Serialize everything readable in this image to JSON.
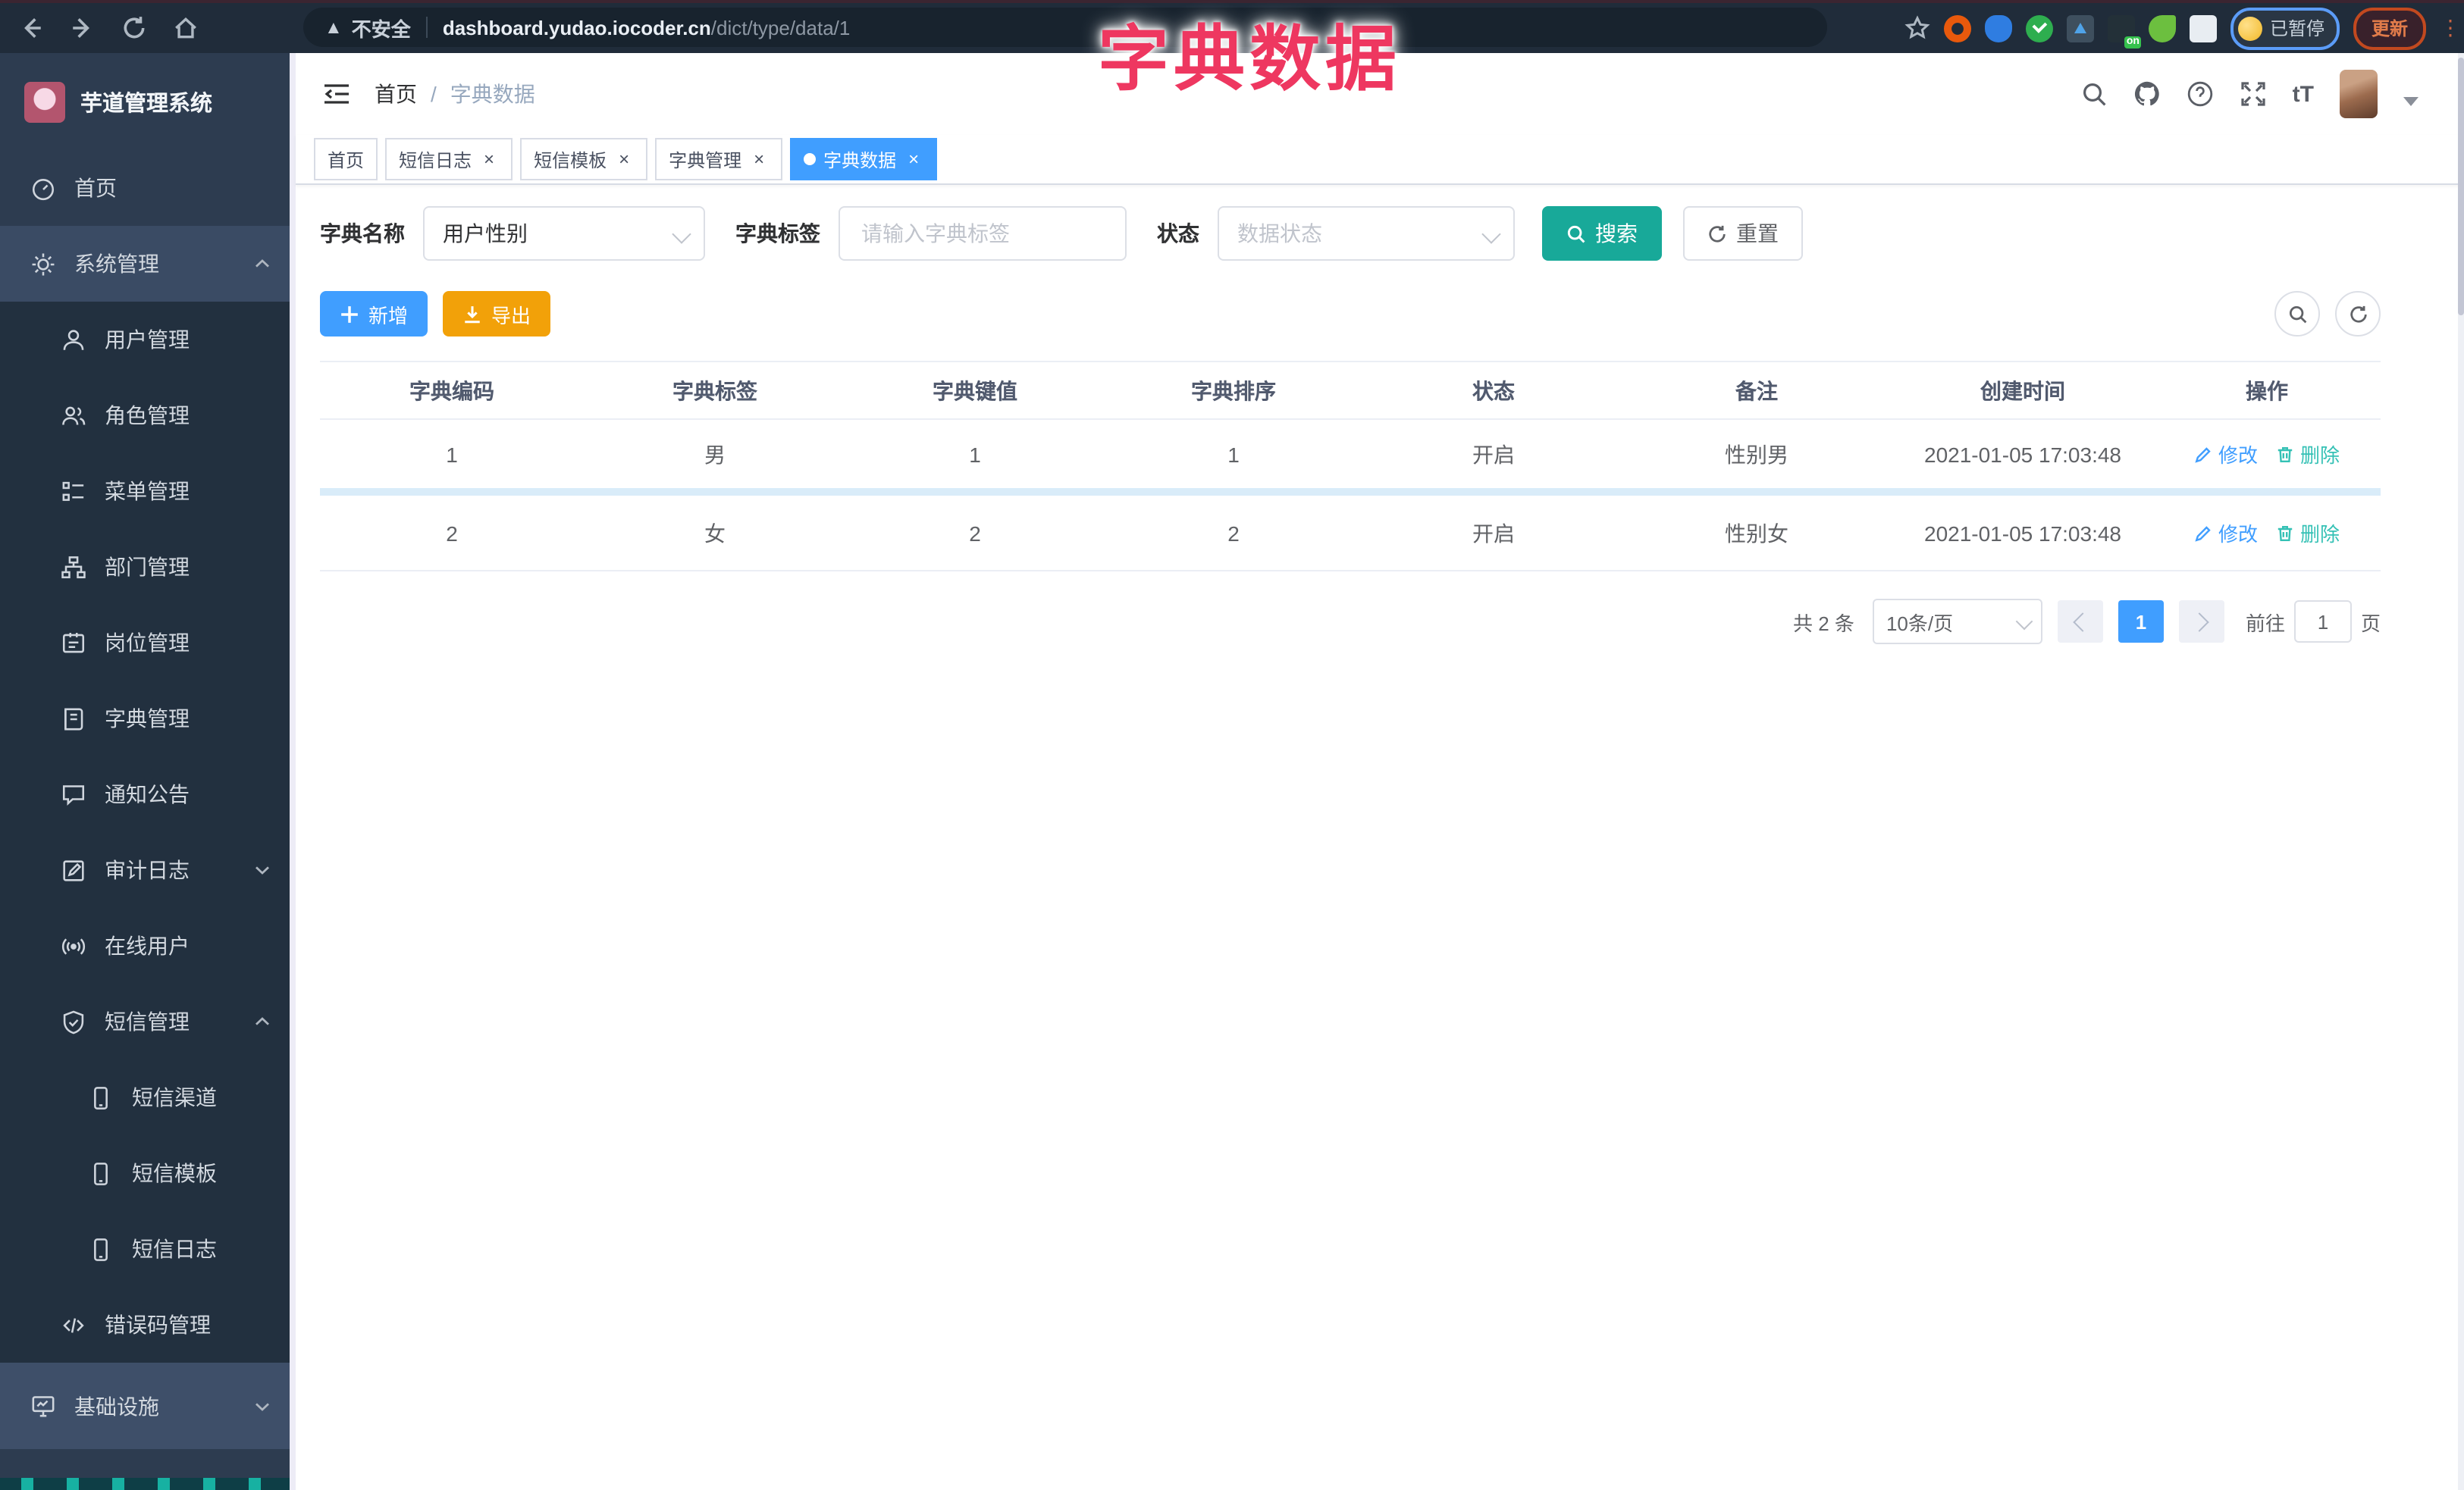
{
  "browser": {
    "security_label": "不安全",
    "url_host": "dashboard.yudao.iocoder.cn",
    "url_path": "/dict/type/data/1",
    "ext_on_badge": "on",
    "profile_status": "已暂停",
    "update_label": "更新",
    "extension_icons": [
      "back-icon",
      "forward-icon",
      "reload-icon",
      "home-icon",
      "bookmark-star-icon",
      "orange-extension-icon",
      "blue-extension-icon",
      "green-check-extension-icon",
      "levels-extension-icon",
      "on-badge-extension-icon",
      "sprout-extension-icon",
      "puzzle-extensions-icon",
      "profile-avatar",
      "kebab-menu-icon"
    ]
  },
  "overlay_title": "字典数据",
  "sidebar": {
    "app_title": "芋道管理系统",
    "items": [
      {
        "label": "首页",
        "icon": "dashboard-icon"
      },
      {
        "label": "系统管理",
        "icon": "gear-icon"
      },
      {
        "label": "用户管理",
        "icon": "user-icon"
      },
      {
        "label": "角色管理",
        "icon": "roles-icon"
      },
      {
        "label": "菜单管理",
        "icon": "menu-list-icon"
      },
      {
        "label": "部门管理",
        "icon": "org-tree-icon"
      },
      {
        "label": "岗位管理",
        "icon": "post-card-icon"
      },
      {
        "label": "字典管理",
        "icon": "dict-book-icon"
      },
      {
        "label": "通知公告",
        "icon": "notice-bubble-icon"
      },
      {
        "label": "审计日志",
        "icon": "audit-edit-icon"
      },
      {
        "label": "在线用户",
        "icon": "online-signal-icon"
      },
      {
        "label": "短信管理",
        "icon": "shield-check-icon"
      },
      {
        "label": "短信渠道",
        "icon": "phone-icon"
      },
      {
        "label": "短信模板",
        "icon": "phone-icon"
      },
      {
        "label": "短信日志",
        "icon": "phone-icon"
      },
      {
        "label": "错误码管理",
        "icon": "code-icon"
      },
      {
        "label": "基础设施",
        "icon": "monitor-icon"
      }
    ]
  },
  "header": {
    "breadcrumb_home": "首页",
    "breadcrumb_sep": "/",
    "breadcrumb_current": "字典数据",
    "font_size_glyph": "tT"
  },
  "tabs": [
    {
      "label": "首页",
      "closable": false,
      "active": false
    },
    {
      "label": "短信日志",
      "closable": true,
      "active": false
    },
    {
      "label": "短信模板",
      "closable": true,
      "active": false
    },
    {
      "label": "字典管理",
      "closable": true,
      "active": false
    },
    {
      "label": "字典数据",
      "closable": true,
      "active": true
    }
  ],
  "close_glyph": "×",
  "filters": {
    "name_label": "字典名称",
    "name_value": "用户性别",
    "label_label": "字典标签",
    "label_placeholder": "请输入字典标签",
    "status_label": "状态",
    "status_placeholder": "数据状态",
    "search_label": "搜索",
    "reset_label": "重置"
  },
  "toolbar": {
    "add_label": "新增",
    "export_label": "导出"
  },
  "table": {
    "headers": [
      "字典编码",
      "字典标签",
      "字典键值",
      "字典排序",
      "状态",
      "备注",
      "创建时间",
      "操作"
    ],
    "rows": [
      [
        "1",
        "男",
        "1",
        "1",
        "开启",
        "性别男",
        "2021-01-05 17:03:48"
      ],
      [
        "2",
        "女",
        "2",
        "2",
        "开启",
        "性别女",
        "2021-01-05 17:03:48"
      ]
    ],
    "actions": {
      "edit": "修改",
      "delete": "删除"
    }
  },
  "pagination": {
    "total": "共 2 条",
    "page_size": "10条/页",
    "current": "1",
    "goto_label": "前往",
    "goto_value": "1",
    "page_unit": "页"
  },
  "colors": {
    "primary": "#409eff",
    "search_teal": "#18a999",
    "export_orange": "#f2a109",
    "delete_teal": "#35c1b5",
    "overlay_pink": "#ee3760",
    "sidebar_bg": "#2d3c50",
    "submenu_bg": "#22303f",
    "active_tab": "#409eff"
  }
}
